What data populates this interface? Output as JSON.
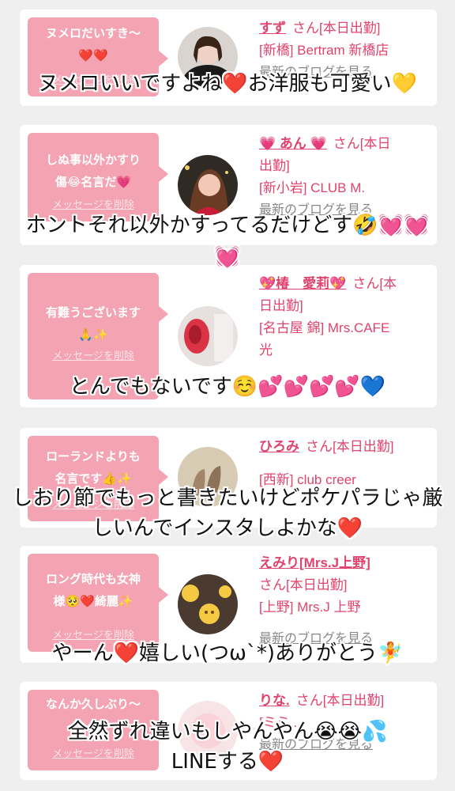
{
  "cards": [
    {
      "bubble_lines": [
        "ヌメロだいすき〜",
        "❤️❤️"
      ],
      "delete_label": "メッセージを削除",
      "name": "すず",
      "suffix": "さん[本日出勤]",
      "area_lines": [
        "[新橋] Bertram 新橋店"
      ],
      "blog_label": "最新のブログを見る"
    },
    {
      "bubble_lines": [
        "しぬ事以外かすり",
        "傷😂名言だ💗"
      ],
      "delete_label": "メッセージを削除",
      "name": "💗 あん 💗",
      "suffix": "さん[本日",
      "suffix2": "出勤]",
      "area_lines": [
        "[新小岩] CLUB M."
      ],
      "blog_label": "最新のブログを見る"
    },
    {
      "bubble_lines": [
        "有難うございます",
        "🙏✨"
      ],
      "delete_label": "メッセージを削除",
      "name": "💖椿　愛莉💖",
      "suffix": "さん[本",
      "suffix2": "日出勤]",
      "area_lines": [
        "[名古屋 錦] Mrs.CAFE",
        "光"
      ],
      "blog_label": "最新のブログを見る"
    },
    {
      "bubble_lines": [
        "ローランドよりも",
        "名言です👍✨"
      ],
      "delete_label": "メッセージを削除",
      "name": "ひろみ",
      "suffix": "さん[本日出勤]",
      "area_lines": [
        "[西新] club creer"
      ],
      "blog_label": "最新のブログを見る"
    },
    {
      "bubble_lines": [
        "ロング時代も女神",
        "様🥺❤️綺麗✨"
      ],
      "delete_label": "メッセージを削除",
      "name": "えみり[Mrs.J上野]",
      "suffix": "さん[本日出勤]",
      "area_lines": [
        "[上野] Mrs.J 上野"
      ],
      "blog_label": "最新のブログを見る"
    },
    {
      "bubble_lines": [
        "なんか久しぶり〜",
        ""
      ],
      "delete_label": "メッセージを削除",
      "name": "りな.",
      "suffix": "さん[本日出勤]",
      "area_lines": [
        "[ミミ..."
      ],
      "blog_label": "最新のブログを見る"
    }
  ],
  "comments": [
    "ヌメロいいですよね❤️お洋服も可愛い💛",
    "ホントそれ以外かすってるだけどす🤣💓💓💓",
    "とんでもないです☺️💕💕💕💕💙",
    "しおり節でもっと書きたいけどポケパラじゃ厳しいんでインスタしよかな❤️",
    "やーん❤️嬉しい(つω`*)ありがとう🧚",
    "全然ずれ違いもしやんやん😭😭💦LINEする❤️"
  ]
}
